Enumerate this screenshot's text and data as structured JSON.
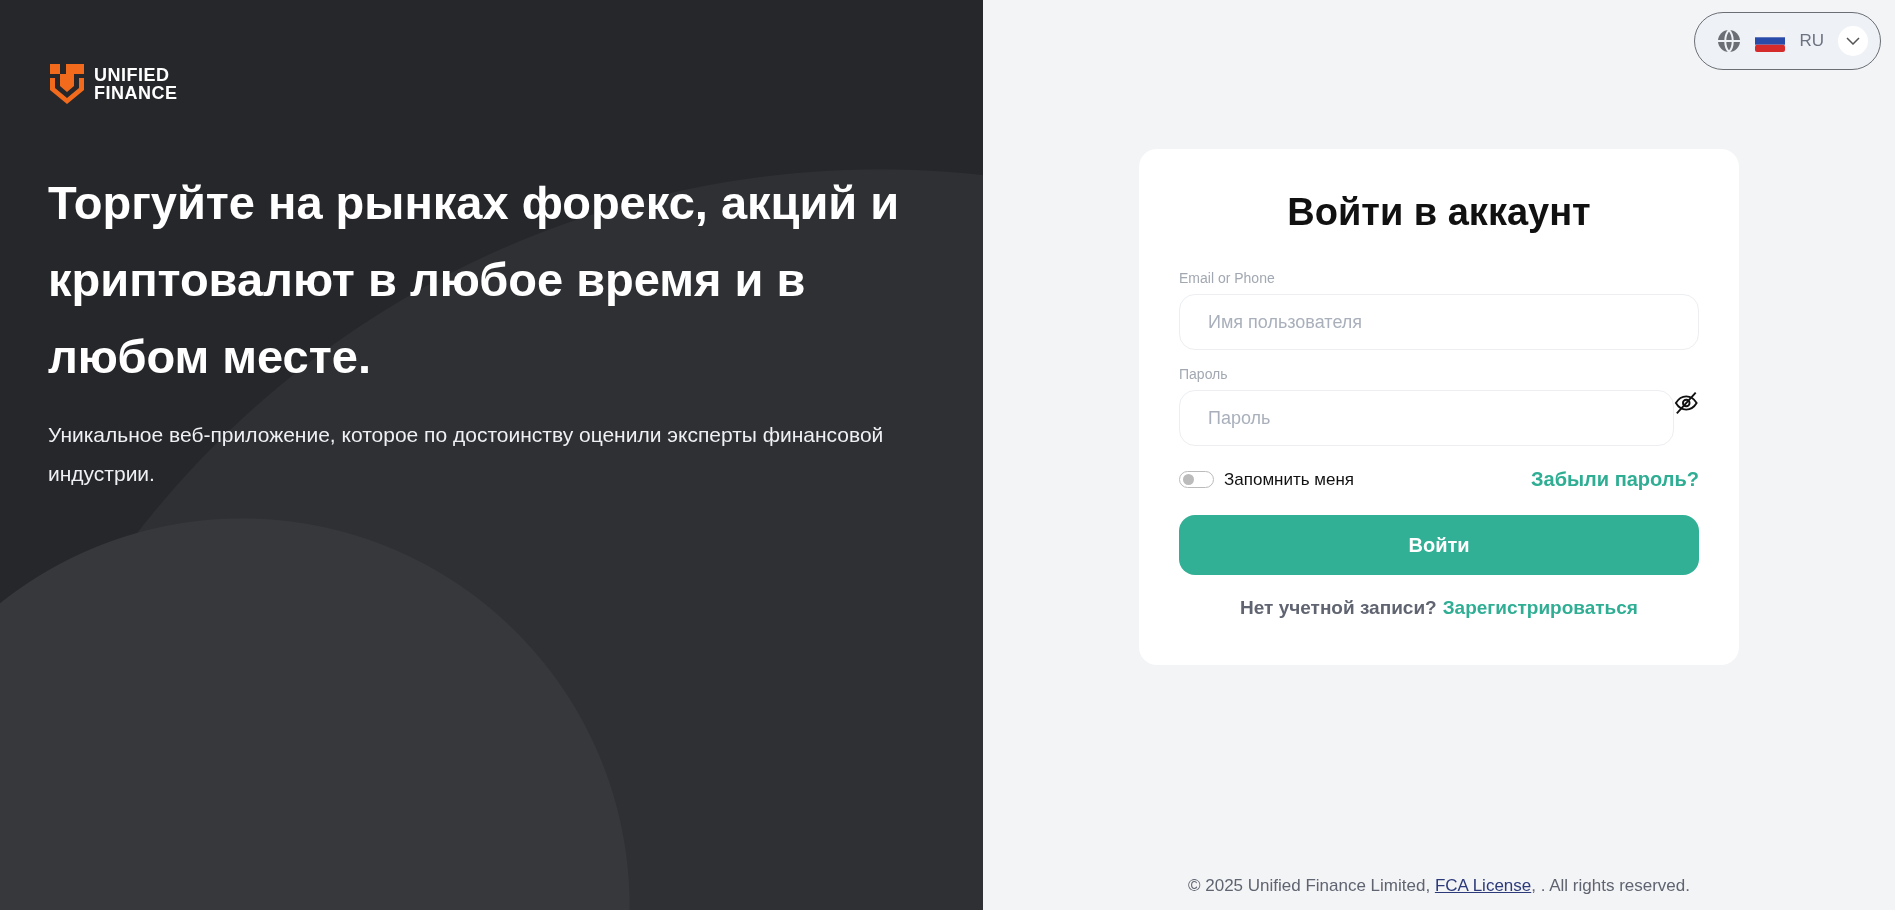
{
  "brand": {
    "line1": "UNIFIED",
    "line2": "FINANCE"
  },
  "hero": {
    "headline": "Торгуйте на рынках форекс, акций и криптовалют в любое время и в любом месте.",
    "subtitle": "Уникальное веб-приложение, которое по достоинству оценили эксперты финансовой индустрии."
  },
  "language": {
    "code": "RU"
  },
  "login": {
    "title": "Войти в аккаунт",
    "fields": [
      {
        "label": "Email or Phone",
        "placeholder": "Имя пользователя",
        "kind": "text"
      },
      {
        "label": "Пароль",
        "placeholder": "Пароль",
        "kind": "password"
      }
    ],
    "remember": {
      "label": "Запомнить меня",
      "on": false
    },
    "forgot": "Забыли пароль?",
    "submit": "Войти",
    "signup_prompt": "Нет учетной записи?",
    "signup_link": "Зарегистрироваться"
  },
  "footer": {
    "before": "© 2025 Unified Finance Limited, ",
    "link": "FCA License",
    "after": ", . All rights reserved."
  }
}
